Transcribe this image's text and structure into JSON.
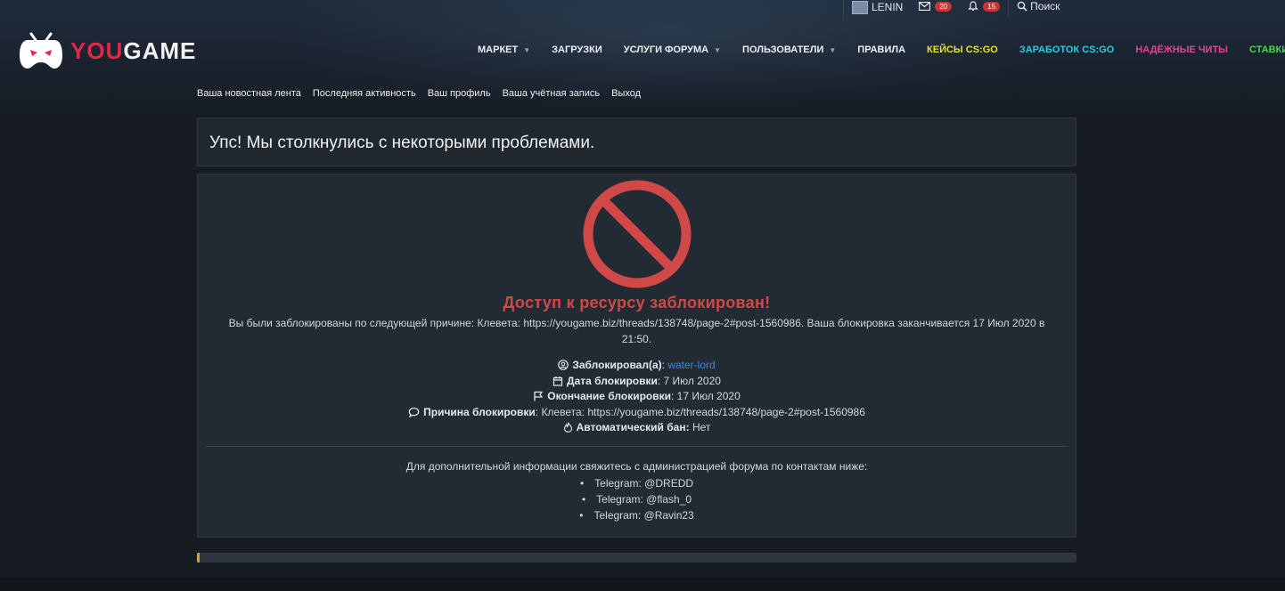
{
  "topbar": {
    "username": "LENIN",
    "messages_count": "20",
    "alerts_count": "15",
    "search_label": "Поиск"
  },
  "logo": {
    "part1": "YOU",
    "part2": "GAME"
  },
  "nav": {
    "items": [
      {
        "label": "МАРКЕТ",
        "has_caret": true,
        "color": "#ecf0f4"
      },
      {
        "label": "ЗАГРУЗКИ",
        "has_caret": false,
        "color": "#ecf0f4"
      },
      {
        "label": "УСЛУГИ ФОРУМА",
        "has_caret": true,
        "color": "#ecf0f4"
      },
      {
        "label": "ПОЛЬЗОВАТЕЛИ",
        "has_caret": true,
        "color": "#ecf0f4"
      },
      {
        "label": "ПРАВИЛА",
        "has_caret": false,
        "color": "#ecf0f4"
      },
      {
        "label": "КЕЙСЫ CS:GO",
        "has_caret": false,
        "color": "#e8e22c"
      },
      {
        "label": "ЗАРАБОТОК CS:GO",
        "has_caret": false,
        "color": "#2ec8e0"
      },
      {
        "label": "НАДЁЖНЫЕ ЧИТЫ",
        "has_caret": false,
        "color": "#e0459a"
      },
      {
        "label": "СТАВКИ CS:GO",
        "has_caret": false,
        "color": "#4cd44c"
      }
    ]
  },
  "subnav": {
    "items": [
      "Ваша новостная лента",
      "Последняя активность",
      "Ваш профиль",
      "Ваша учётная запись",
      "Выход"
    ]
  },
  "page": {
    "title": "Упс! Мы столкнулись с некоторыми проблемами."
  },
  "ban": {
    "title": "Доступ к ресурсу заблокирован!",
    "reason_line1": "Вы были заблокированы по следующей причине: Клевета: https://yougame.biz/threads/138748/page-2#post-1560986. Ваша блокировка заканчивается 17 Июл 2020 в",
    "reason_line2": "21:50.",
    "banned_by_label": "Заблокировал(а)",
    "banned_by_value": "water-lord",
    "date_label": "Дата блокировки",
    "date_value": "7 Июл 2020",
    "end_label": "Окончание блокировки",
    "end_value": "17 Июл 2020",
    "cause_label": "Причина блокировки",
    "cause_value": "Клевета: https://yougame.biz/threads/138748/page-2#post-1560986",
    "auto_label": "Автоматический бан:",
    "auto_value": "Нет",
    "contact_intro": "Для дополнительной информации свяжитесь с администрацией форума по контактам ниже:",
    "contacts": [
      "Telegram: @DREDD",
      "Telegram: @flash_0",
      "Telegram: @Ravin23"
    ]
  },
  "colors": {
    "accent_red": "#d04848",
    "link_blue": "#3f87d8",
    "brand_red": "#e0284a"
  }
}
